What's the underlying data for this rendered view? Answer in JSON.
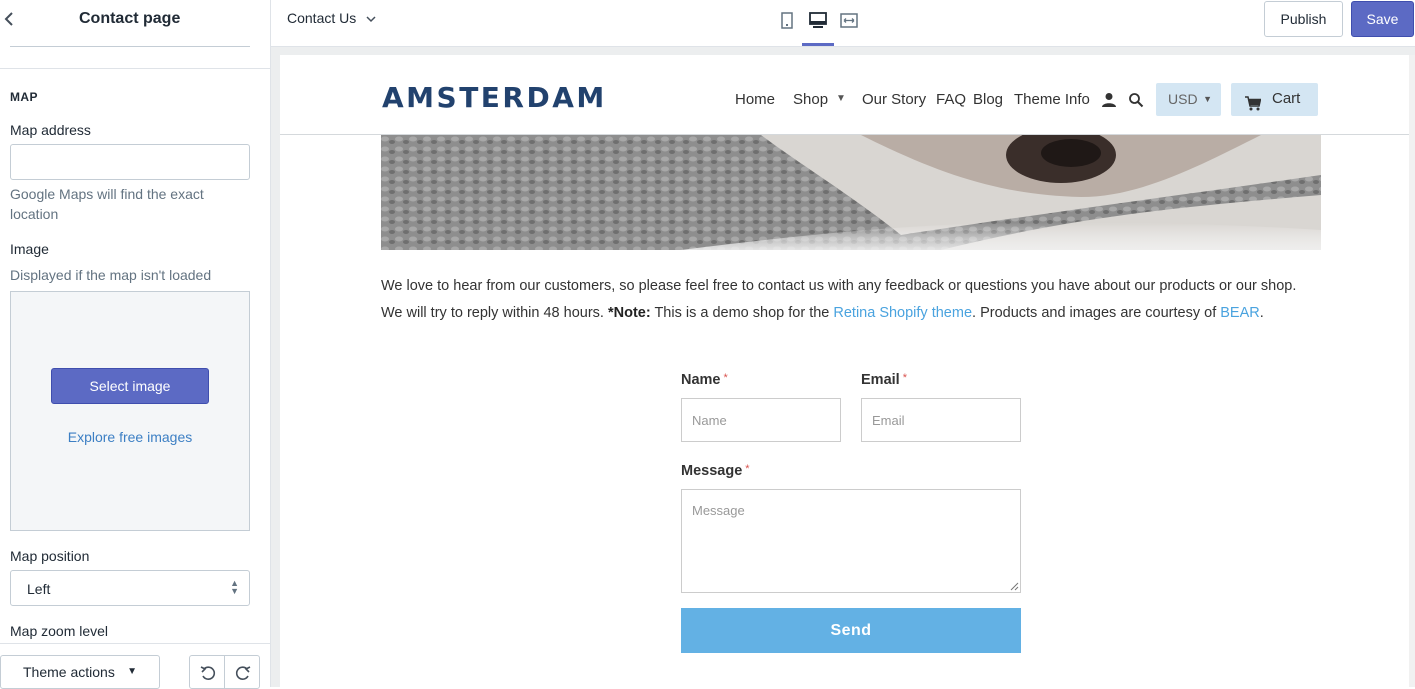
{
  "sidebar": {
    "back_icon": "chevron-left-icon",
    "title": "Contact page",
    "section_heading": "MAP",
    "map_address": {
      "label": "Map address",
      "value": "",
      "help": "Google Maps will find the exact location"
    },
    "image": {
      "label": "Image",
      "help": "Displayed if the map isn't loaded",
      "select_button": "Select image",
      "explore_link": "Explore free images"
    },
    "map_position": {
      "label": "Map position",
      "selected": "Left"
    },
    "map_zoom_label": "Map zoom level",
    "footer": {
      "theme_actions": "Theme actions",
      "undo_icon": "undo-icon",
      "redo_icon": "redo-icon"
    }
  },
  "topbar": {
    "page_selector": "Contact Us",
    "devices": [
      "mobile-icon",
      "desktop-icon",
      "fullwidth-icon"
    ],
    "active_device": "desktop",
    "publish": "Publish",
    "save": "Save",
    "accent_color": "#5c6ac4"
  },
  "store": {
    "logo": "AMSTERDAM",
    "nav": {
      "home": "Home",
      "shop": "Shop",
      "our_story": "Our Story",
      "faq": "FAQ",
      "blog": "Blog",
      "theme_info": "Theme Info"
    },
    "currency": "USD",
    "cart": "Cart",
    "intro": {
      "line1": "We love to hear from our customers, so please feel free to contact us with any feedback or questions you have about our products or our shop.",
      "line2_a": "We will try to reply within 48 hours. ",
      "note_label": "*Note:",
      "line2_b": " This is a demo shop for the ",
      "link1": "Retina Shopify theme",
      "line2_c": ". Products and images are courtesy of ",
      "link2": "BEAR",
      "line2_d": "."
    },
    "form": {
      "name_label": "Name",
      "name_placeholder": "Name",
      "email_label": "Email",
      "email_placeholder": "Email",
      "message_label": "Message",
      "message_placeholder": "Message",
      "required_mark": "*",
      "send": "Send"
    },
    "colors": {
      "logo": "#22426e",
      "link": "#4aa3df",
      "send_button": "#63b1e4",
      "pill_bg": "#d4e6f3"
    }
  }
}
